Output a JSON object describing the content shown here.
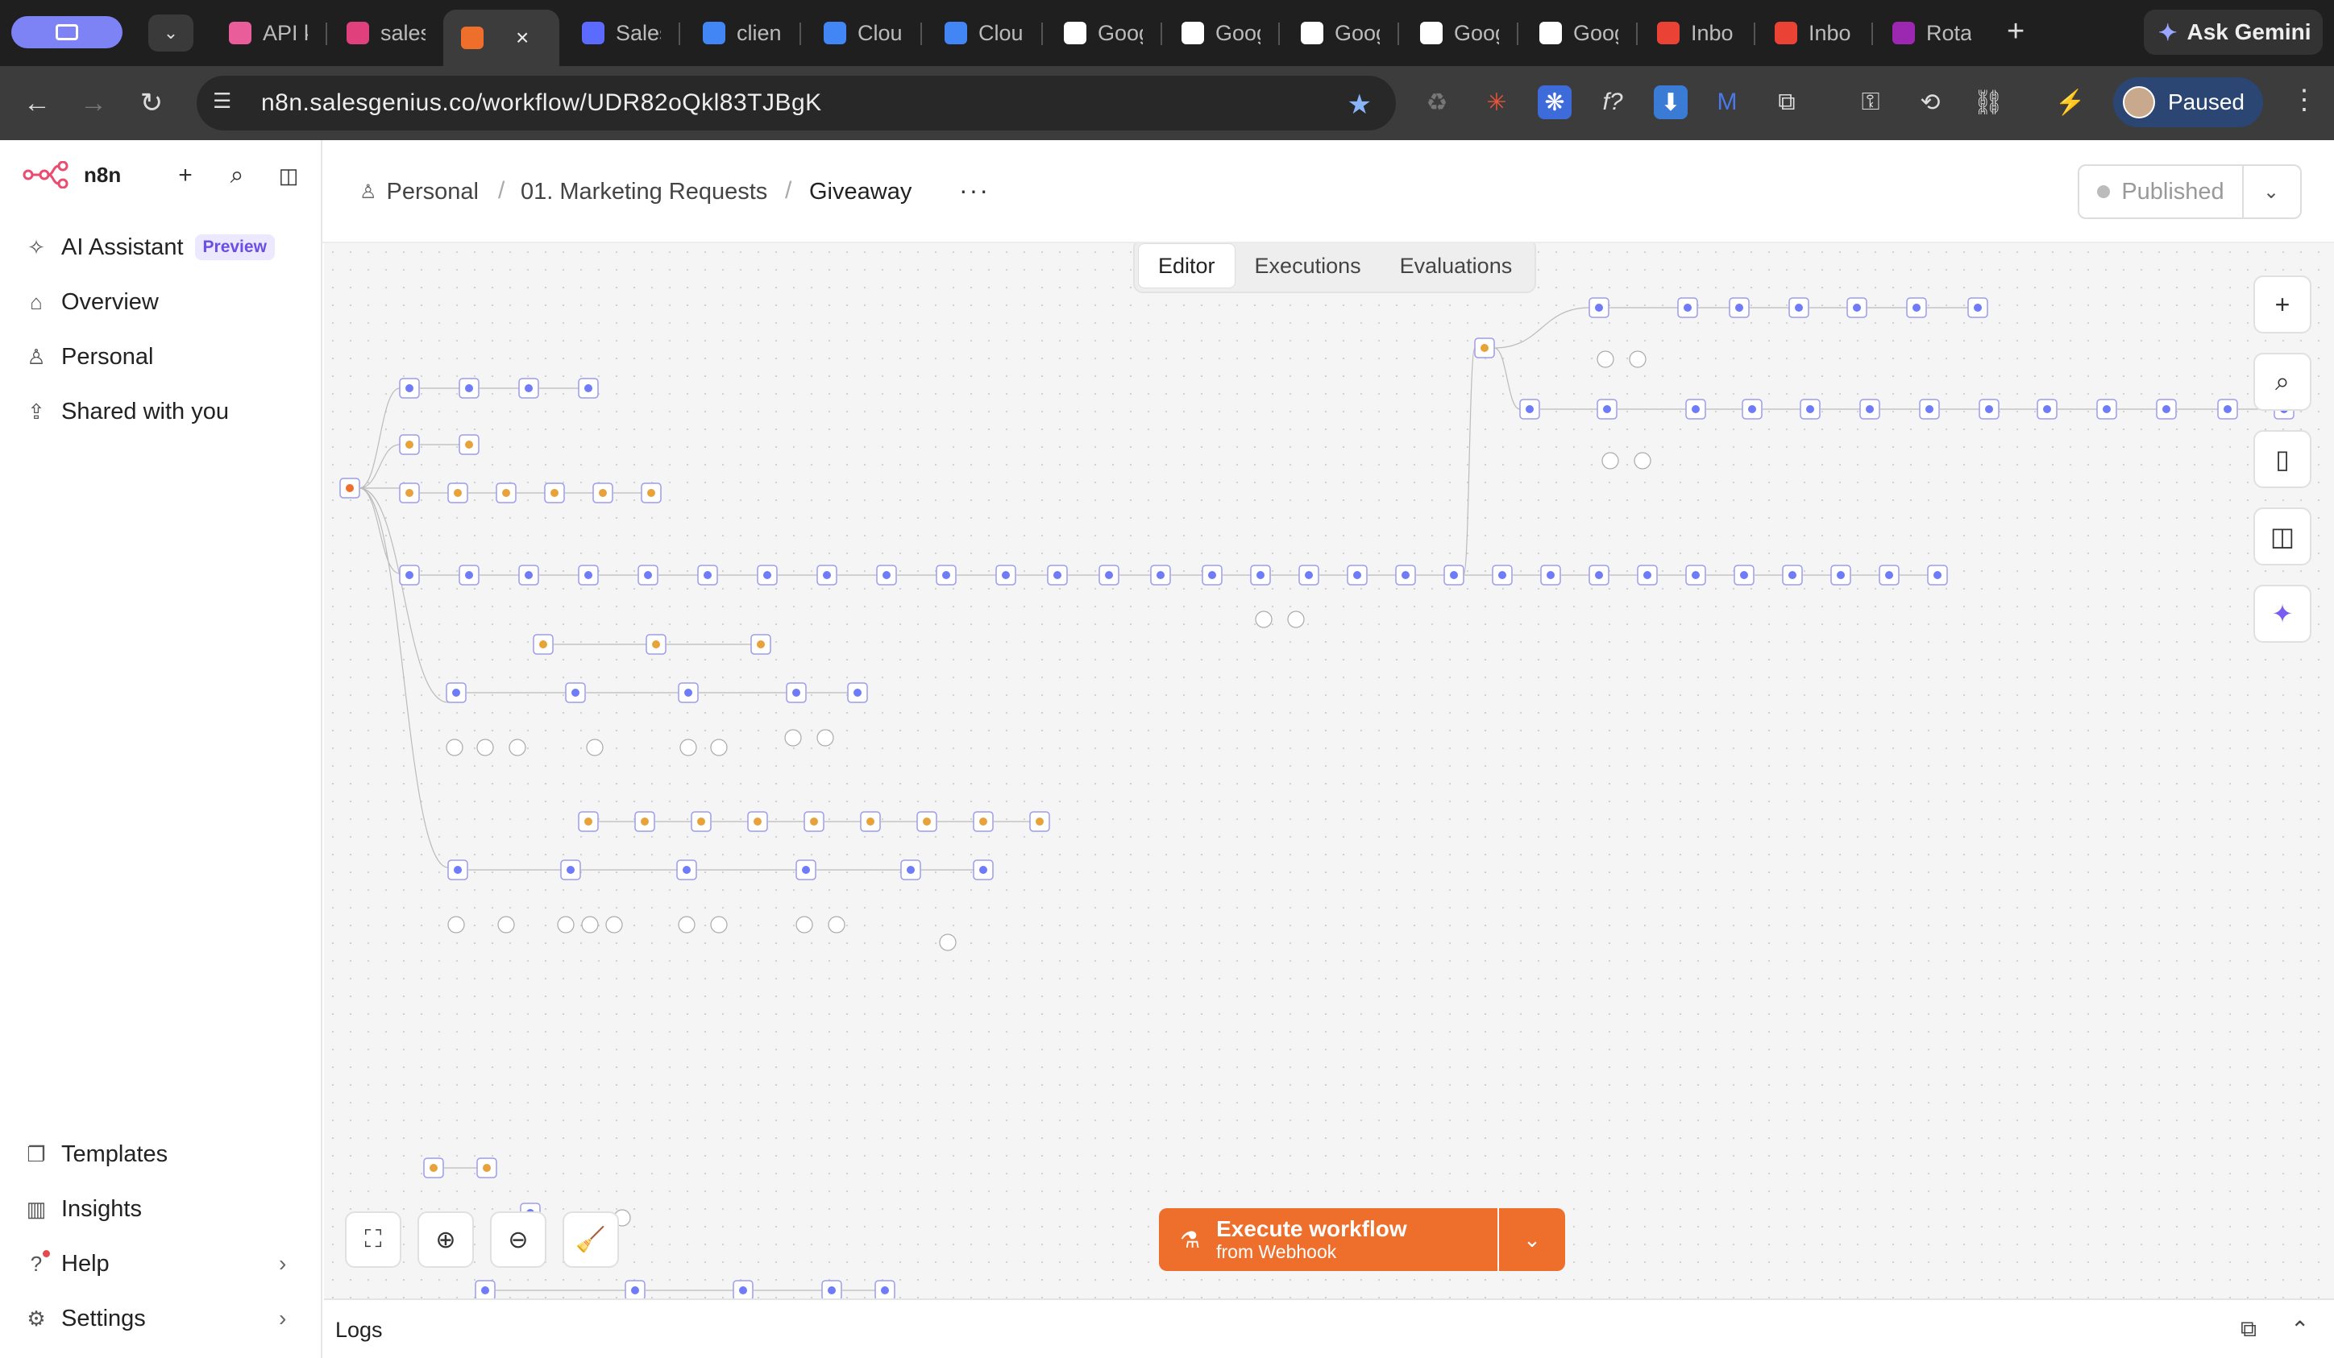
{
  "browser": {
    "tabs": [
      {
        "label": "API k",
        "favicon_color": "#e85d9a"
      },
      {
        "label": "sales",
        "favicon_color": "#e0407c"
      },
      {
        "label": "",
        "favicon_color": "#ee6e2c",
        "active": true
      },
      {
        "label": "Sales",
        "favicon_color": "#5b6bff"
      },
      {
        "label": "clien",
        "favicon_color": "#4285f4"
      },
      {
        "label": "Clou",
        "favicon_color": "#4285f4"
      },
      {
        "label": "Clou",
        "favicon_color": "#4285f4"
      },
      {
        "label": "Goog",
        "favicon_color": "#ffffff"
      },
      {
        "label": "Goog",
        "favicon_color": "#ffffff"
      },
      {
        "label": "Goog",
        "favicon_color": "#ffffff"
      },
      {
        "label": "Goog",
        "favicon_color": "#ffffff"
      },
      {
        "label": "Goog",
        "favicon_color": "#ffffff"
      },
      {
        "label": "Inbo",
        "favicon_color": "#ea4335"
      },
      {
        "label": "Inbo",
        "favicon_color": "#ea4335"
      },
      {
        "label": "Rota",
        "favicon_color": "#9c27b0"
      }
    ],
    "gemini_label": "Ask Gemini",
    "url": "n8n.salesgenius.co/workflow/UDR82oQkl83TJBgK",
    "profile_label": "Paused"
  },
  "sidebar": {
    "brand": "n8n",
    "items": [
      {
        "label": "AI Assistant",
        "badge": "Preview",
        "icon": "sparkle-icon"
      },
      {
        "label": "Overview",
        "icon": "home-icon"
      },
      {
        "label": "Personal",
        "icon": "user-icon"
      },
      {
        "label": "Shared with you",
        "icon": "share-icon"
      }
    ],
    "bottom_items": [
      {
        "label": "Templates",
        "icon": "templates-icon"
      },
      {
        "label": "Insights",
        "icon": "insights-icon"
      },
      {
        "label": "Help",
        "icon": "help-icon"
      },
      {
        "label": "Settings",
        "icon": "settings-icon"
      }
    ]
  },
  "header": {
    "breadcrumb": [
      "Personal",
      "01. Marketing Requests",
      "Giveaway"
    ],
    "publish_label": "Published"
  },
  "canvas": {
    "tabs": [
      "Editor",
      "Executions",
      "Evaluations"
    ],
    "active_tab": "Editor",
    "execute_label": "Execute workflow",
    "execute_sub": "from Webhook"
  },
  "logs": {
    "label": "Logs"
  },
  "colors": {
    "accent": "#ee6e2c",
    "node_border": "#9c9cf0",
    "profile": "#2b4673"
  }
}
